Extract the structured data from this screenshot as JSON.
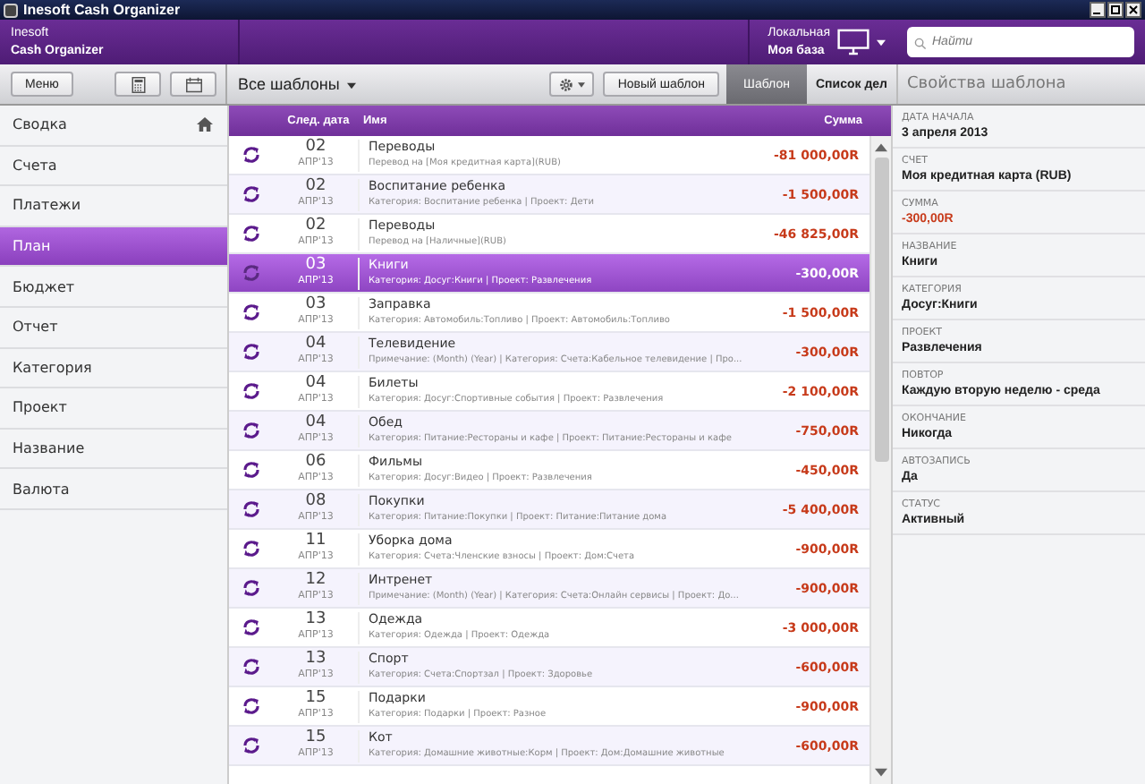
{
  "window": {
    "title": "Inesoft Cash Organizer"
  },
  "header": {
    "brand_line1": "Inesoft",
    "brand_line2": "Cash Organizer",
    "db_label": "Локальная",
    "db_name": "Моя база",
    "search": {
      "placeholder": "Найти"
    }
  },
  "toolbar": {
    "menu_button": "Меню",
    "filter": "Все шаблоны",
    "new_button": "Новый шаблон",
    "tabs": [
      {
        "label": "Шаблон",
        "selected": true
      },
      {
        "label": "Список дел",
        "selected": false
      }
    ],
    "panel_title": "Свойства шаблона"
  },
  "sidebar": {
    "items": [
      {
        "label": "Сводка",
        "selected": false,
        "home": true
      },
      {
        "label": "Счета",
        "selected": false
      },
      {
        "label": "Платежи",
        "selected": false
      },
      {
        "label": "План",
        "selected": true
      },
      {
        "label": "Бюджет",
        "selected": false
      },
      {
        "label": "Отчет",
        "selected": false
      },
      {
        "label": "Категория",
        "selected": false
      },
      {
        "label": "Проект",
        "selected": false
      },
      {
        "label": "Название",
        "selected": false
      },
      {
        "label": "Валюта",
        "selected": false
      }
    ]
  },
  "table": {
    "columns": [
      "След. дата",
      "Имя",
      "Сумма"
    ],
    "rows": [
      {
        "day": "02",
        "month": "АПР'13",
        "name": "Переводы",
        "details": "Перевод на [Моя кредитная карта](RUB)",
        "amount": "-81 000,00R",
        "selected": false
      },
      {
        "day": "02",
        "month": "АПР'13",
        "name": "Воспитание ребенка",
        "details": "Категория: Воспитание ребенка | Проект: Дети",
        "amount": "-1 500,00R",
        "selected": false
      },
      {
        "day": "02",
        "month": "АПР'13",
        "name": "Переводы",
        "details": "Перевод на [Наличные](RUB)",
        "amount": "-46 825,00R",
        "selected": false
      },
      {
        "day": "03",
        "month": "АПР'13",
        "name": "Книги",
        "details": "Категория: Досуг:Книги | Проект: Развлечения",
        "amount": "-300,00R",
        "selected": true
      },
      {
        "day": "03",
        "month": "АПР'13",
        "name": "Заправка",
        "details": "Категория: Автомобиль:Топливо | Проект: Автомобиль:Топливо",
        "amount": "-1 500,00R",
        "selected": false
      },
      {
        "day": "04",
        "month": "АПР'13",
        "name": "Телевидение",
        "details": "Примечание: (Month) (Year) | Категория: Счета:Кабельное телевидение | Про...",
        "amount": "-300,00R",
        "selected": false
      },
      {
        "day": "04",
        "month": "АПР'13",
        "name": "Билеты",
        "details": "Категория: Досуг:Спортивные события | Проект: Развлечения",
        "amount": "-2 100,00R",
        "selected": false
      },
      {
        "day": "04",
        "month": "АПР'13",
        "name": "Обед",
        "details": "Категория: Питание:Рестораны и кафе | Проект: Питание:Рестораны и кафе",
        "amount": "-750,00R",
        "selected": false
      },
      {
        "day": "06",
        "month": "АПР'13",
        "name": "Фильмы",
        "details": "Категория: Досуг:Видео | Проект: Развлечения",
        "amount": "-450,00R",
        "selected": false
      },
      {
        "day": "08",
        "month": "АПР'13",
        "name": "Покупки",
        "details": "Категория: Питание:Покупки | Проект: Питание:Питание дома",
        "amount": "-5 400,00R",
        "selected": false
      },
      {
        "day": "11",
        "month": "АПР'13",
        "name": "Уборка дома",
        "details": "Категория: Счета:Членские взносы | Проект: Дом:Счета",
        "amount": "-900,00R",
        "selected": false
      },
      {
        "day": "12",
        "month": "АПР'13",
        "name": "Интренет",
        "details": "Примечание: (Month) (Year) | Категория: Счета:Онлайн сервисы | Проект: До...",
        "amount": "-900,00R",
        "selected": false
      },
      {
        "day": "13",
        "month": "АПР'13",
        "name": "Одежда",
        "details": "Категория: Одежда | Проект: Одежда",
        "amount": "-3 000,00R",
        "selected": false
      },
      {
        "day": "13",
        "month": "АПР'13",
        "name": "Спорт",
        "details": "Категория: Счета:Спортзал | Проект: Здоровье",
        "amount": "-600,00R",
        "selected": false
      },
      {
        "day": "15",
        "month": "АПР'13",
        "name": "Подарки",
        "details": "Категория: Подарки | Проект: Разное",
        "amount": "-900,00R",
        "selected": false
      },
      {
        "day": "15",
        "month": "АПР'13",
        "name": "Кот",
        "details": "Категория: Домашние животные:Корм | Проект: Дом:Домашние животные",
        "amount": "-600,00R",
        "selected": false
      }
    ]
  },
  "properties": [
    {
      "label": "ДАТА НАЧАЛА",
      "value": "3 апреля 2013",
      "kind": "text"
    },
    {
      "label": "СЧЕТ",
      "value": "Моя кредитная карта (RUB)",
      "kind": "text"
    },
    {
      "label": "СУММА",
      "value": "-300,00R",
      "kind": "amount"
    },
    {
      "label": "НАЗВАНИЕ",
      "value": "Книги",
      "kind": "text"
    },
    {
      "label": "КАТЕГОРИЯ",
      "value": "Досуг:Книги",
      "kind": "text"
    },
    {
      "label": "ПРОЕКТ",
      "value": "Развлечения",
      "kind": "text"
    },
    {
      "label": "ПОВТОР",
      "value": "Каждую вторую неделю - среда",
      "kind": "text"
    },
    {
      "label": "ОКОНЧАНИЕ",
      "value": "Никогда",
      "kind": "text"
    },
    {
      "label": "АВТОЗАПИСЬ",
      "value": "Да",
      "kind": "text"
    },
    {
      "label": "СТАТУС",
      "value": "Активный",
      "kind": "text"
    }
  ]
}
